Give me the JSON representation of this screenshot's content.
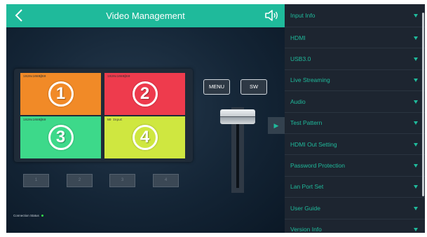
{
  "header": {
    "title": "Video Management",
    "back_icon": "back-chevron-icon",
    "audio_icon": "speaker-icon"
  },
  "preview": {
    "cells": [
      {
        "number": "1",
        "resolution": "1920x1080@60",
        "color": "#f18a27"
      },
      {
        "number": "2",
        "resolution": "1920x1080@60",
        "color": "#ee3b4d"
      },
      {
        "number": "3",
        "resolution": "1920x1080@60",
        "color": "#3dd98a"
      },
      {
        "number": "4",
        "resolution": "NO Input",
        "color": "#cfe740"
      }
    ]
  },
  "source_buttons": [
    "1",
    "2",
    "3",
    "4"
  ],
  "controls": {
    "menu_label": "MENU",
    "sw_label": "SW"
  },
  "status": {
    "label": "Connection Status",
    "indicator_color": "#35e24a"
  },
  "menu": {
    "items": [
      {
        "label": "Input Info"
      },
      {
        "label": "HDMI"
      },
      {
        "label": "USB3.0"
      },
      {
        "label": "Live Streaming"
      },
      {
        "label": "Audio"
      },
      {
        "label": "Test Pattern"
      },
      {
        "label": "HDMI Out Setting"
      },
      {
        "label": "Password Protection"
      },
      {
        "label": "Lan Port Set"
      },
      {
        "label": "User Guide"
      },
      {
        "label": "Version Info"
      }
    ]
  },
  "colors": {
    "accent": "#1fba9b",
    "menu_bg": "#1d2530"
  }
}
